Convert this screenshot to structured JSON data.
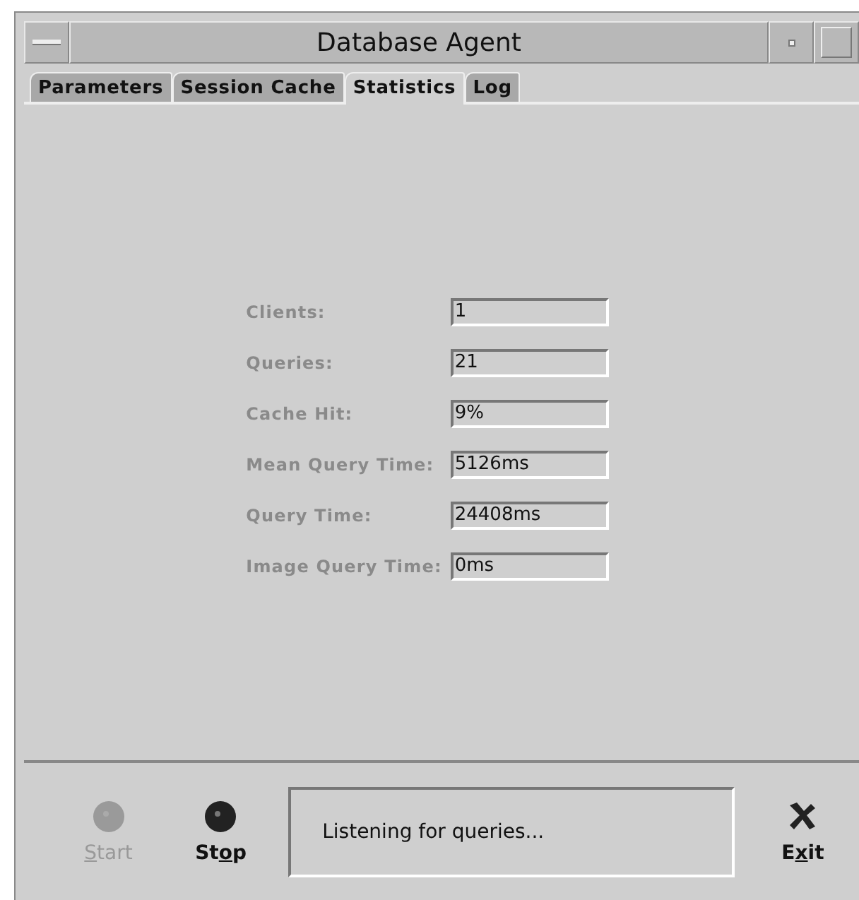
{
  "window": {
    "title": "Database Agent"
  },
  "tabs": [
    {
      "label": "Parameters",
      "selected": false
    },
    {
      "label": "Session Cache",
      "selected": false
    },
    {
      "label": "Statistics",
      "selected": true
    },
    {
      "label": "Log",
      "selected": false
    }
  ],
  "stats": [
    {
      "label": "Clients:",
      "value": "1"
    },
    {
      "label": "Queries:",
      "value": "21"
    },
    {
      "label": "Cache Hit:",
      "value": "9%"
    },
    {
      "label": "Mean Query Time:",
      "value": "5126ms"
    },
    {
      "label": "Query Time:",
      "value": "24408ms"
    },
    {
      "label": "Image Query Time:",
      "value": "0ms"
    }
  ],
  "buttons": [
    {
      "kind": "start",
      "label": {
        "key": "S",
        "after": "tart"
      },
      "disabled": true
    },
    {
      "kind": "stop",
      "label": {
        "before": "St",
        "key": "o",
        "after": "p"
      },
      "disabled": false
    }
  ],
  "status": "Listening for queries...",
  "exit": {
    "label": {
      "before": "E",
      "key": "x",
      "after": "it"
    }
  }
}
